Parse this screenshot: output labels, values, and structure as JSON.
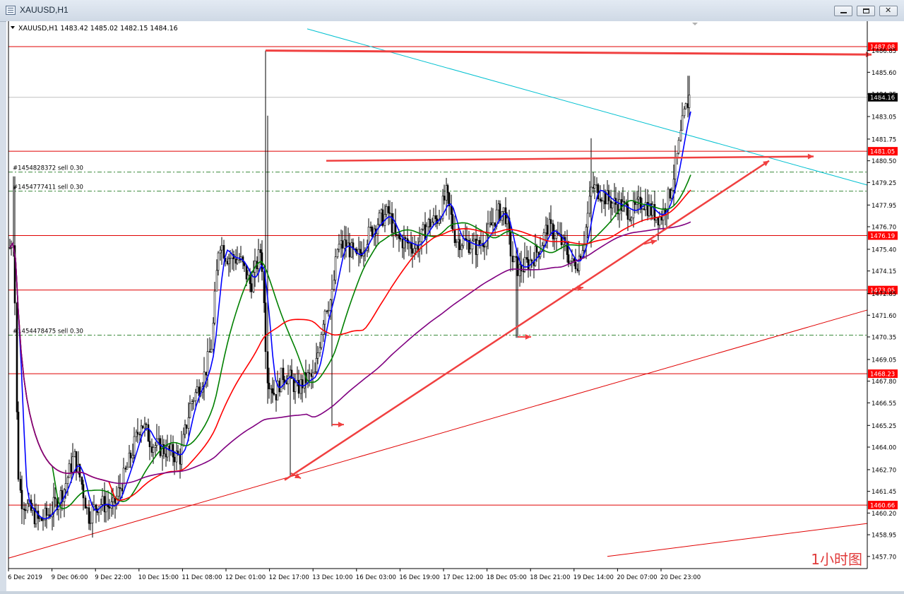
{
  "window": {
    "title": "XAUUSD,H1"
  },
  "chart_data": {
    "type": "candlestick",
    "header": {
      "symbol": "XAUUSD,H1",
      "open": "1483.42",
      "high": "1485.02",
      "low": "1482.15",
      "close": "1484.16"
    },
    "ylim": [
      1457.0,
      1488.3
    ],
    "ytick_labels": [
      "1486.85",
      "1485.60",
      "1484.35",
      "1483.05",
      "1481.75",
      "1480.50",
      "1479.25",
      "1477.95",
      "1476.70",
      "1475.40",
      "1474.15",
      "1472.85",
      "1471.60",
      "1470.35",
      "1469.05",
      "1467.80",
      "1466.55",
      "1465.25",
      "1464.00",
      "1462.70",
      "1461.45",
      "1460.20",
      "1458.95",
      "1457.70"
    ],
    "x_tick_labels": [
      "6 Dec 2019",
      "9 Dec 06:00",
      "9 Dec 22:00",
      "10 Dec 15:00",
      "11 Dec 08:00",
      "12 Dec 01:00",
      "12 Dec 17:00",
      "13 Dec 10:00",
      "16 Dec 03:00",
      "16 Dec 19:00",
      "17 Dec 12:00",
      "18 Dec 05:00",
      "18 Dec 21:00",
      "19 Dec 14:00",
      "20 Dec 07:00",
      "20 Dec 23:00"
    ],
    "current_price": "1484.16",
    "horizontal_levels": [
      {
        "value": 1487.08,
        "label": "1487.08"
      },
      {
        "value": 1481.05,
        "label": "1481.05"
      },
      {
        "value": 1476.19,
        "label": "1476.19"
      },
      {
        "value": 1473.05,
        "label": "1473.05"
      },
      {
        "value": 1468.23,
        "label": "1468.23"
      },
      {
        "value": 1460.66,
        "label": "1460.66"
      }
    ],
    "orders": [
      {
        "label": "#1454828372 sell 0.30",
        "value": 1479.85
      },
      {
        "label": "#1454777411 sell 0.30",
        "value": 1478.75
      },
      {
        "label": "#1454478475 sell 0.30",
        "value": 1470.45
      }
    ],
    "watermark": "1小时图",
    "colors": {
      "candles": "#000000",
      "ma_fast": "#0000ff",
      "ma_mid": "#008000",
      "ma_slow": "#ff0000",
      "ma_long": "#800080",
      "levels": "#e00000",
      "trendline": "#00c0d0",
      "annotation": "#f04040",
      "order_lines": "#3a8a3a",
      "price_label_bg": "#ff0000"
    }
  }
}
